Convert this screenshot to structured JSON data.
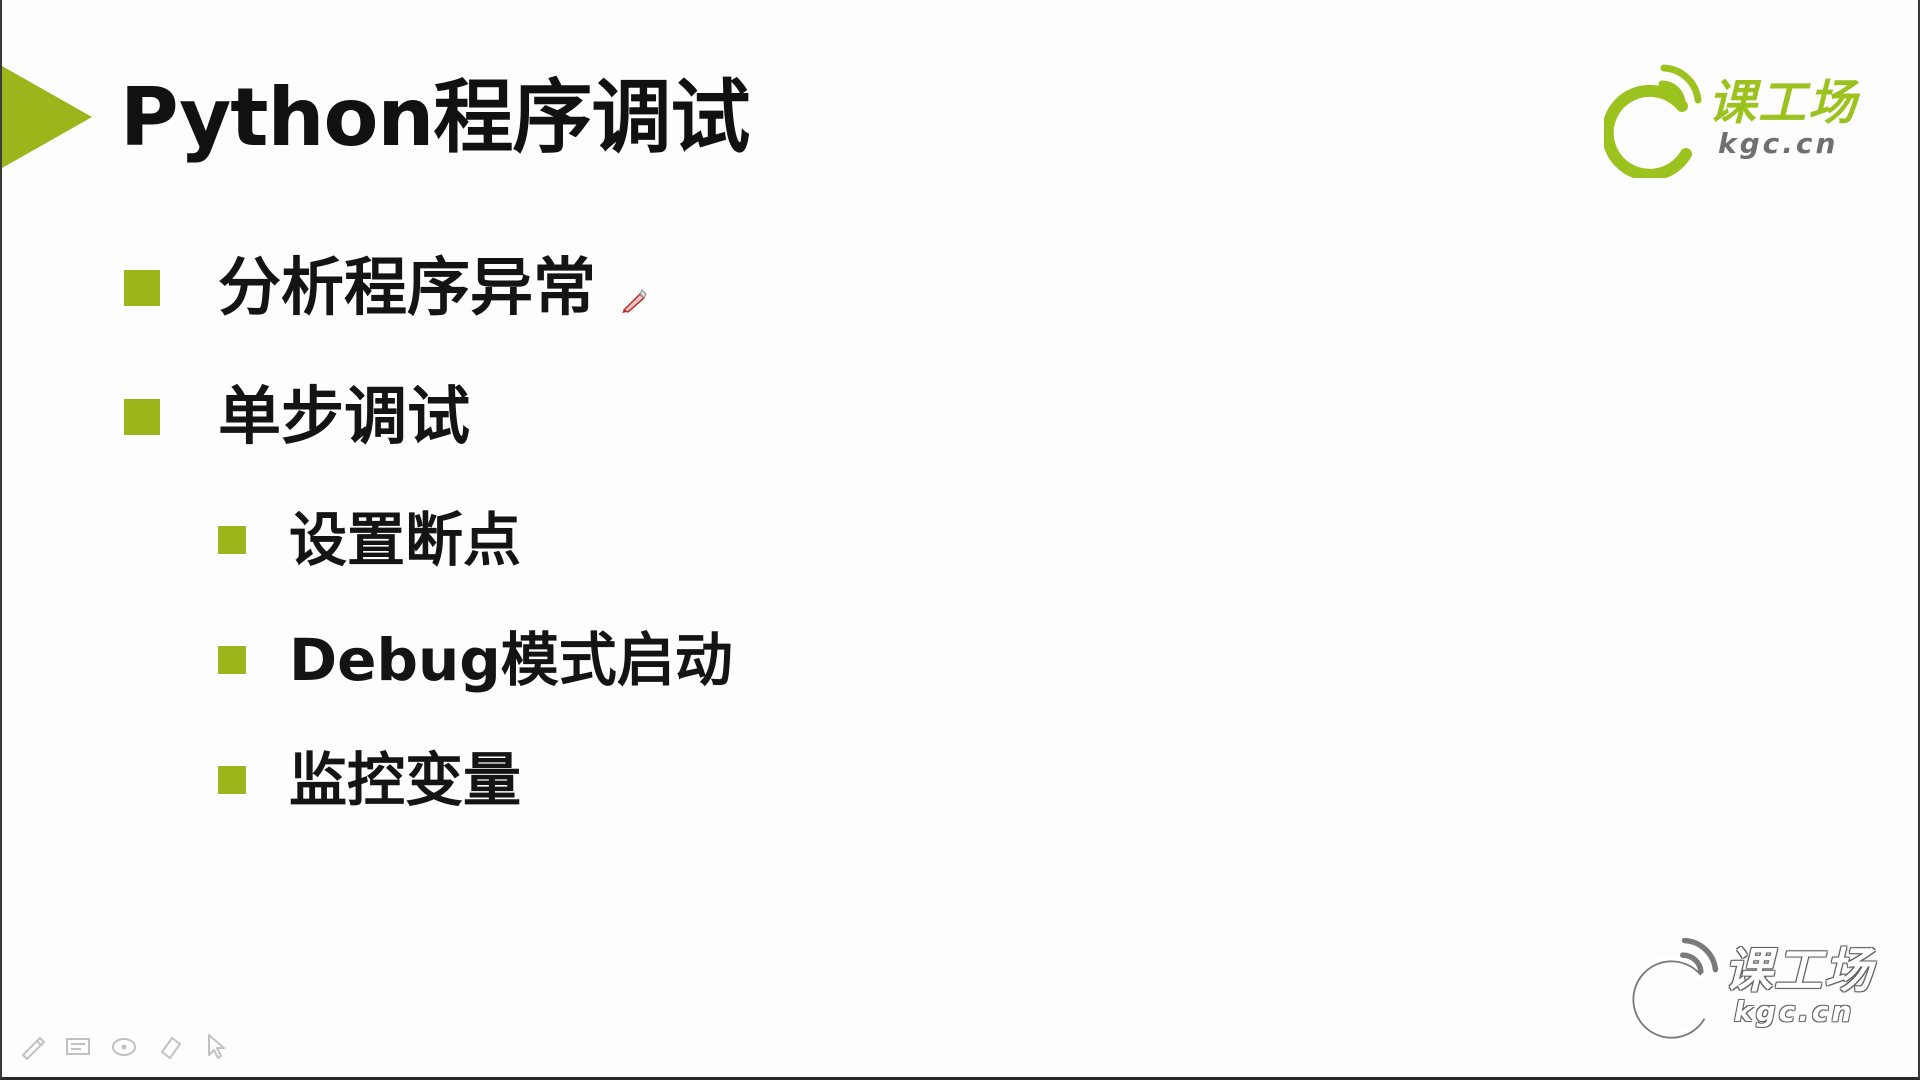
{
  "slide": {
    "title": "Python程序调试",
    "bullets": [
      {
        "label": "分析程序异常"
      },
      {
        "label": "单步调试"
      }
    ],
    "sub_bullets": [
      {
        "label": "设置断点"
      },
      {
        "label": "Debug模式启动"
      },
      {
        "label": "监控变量"
      }
    ]
  },
  "logo_top": {
    "brand_cn": "课工场",
    "brand_en": "kgc.cn"
  },
  "logo_bottom": {
    "brand_cn": "课工场",
    "brand_en": "kgc.cn"
  },
  "toolbar": {
    "icons": [
      "pen-icon",
      "slides-icon",
      "annotate-icon",
      "eraser-icon",
      "pointer-icon"
    ]
  },
  "colors": {
    "accent": "#9bb51b",
    "logo_green": "#9bc21e",
    "text": "#141414"
  }
}
